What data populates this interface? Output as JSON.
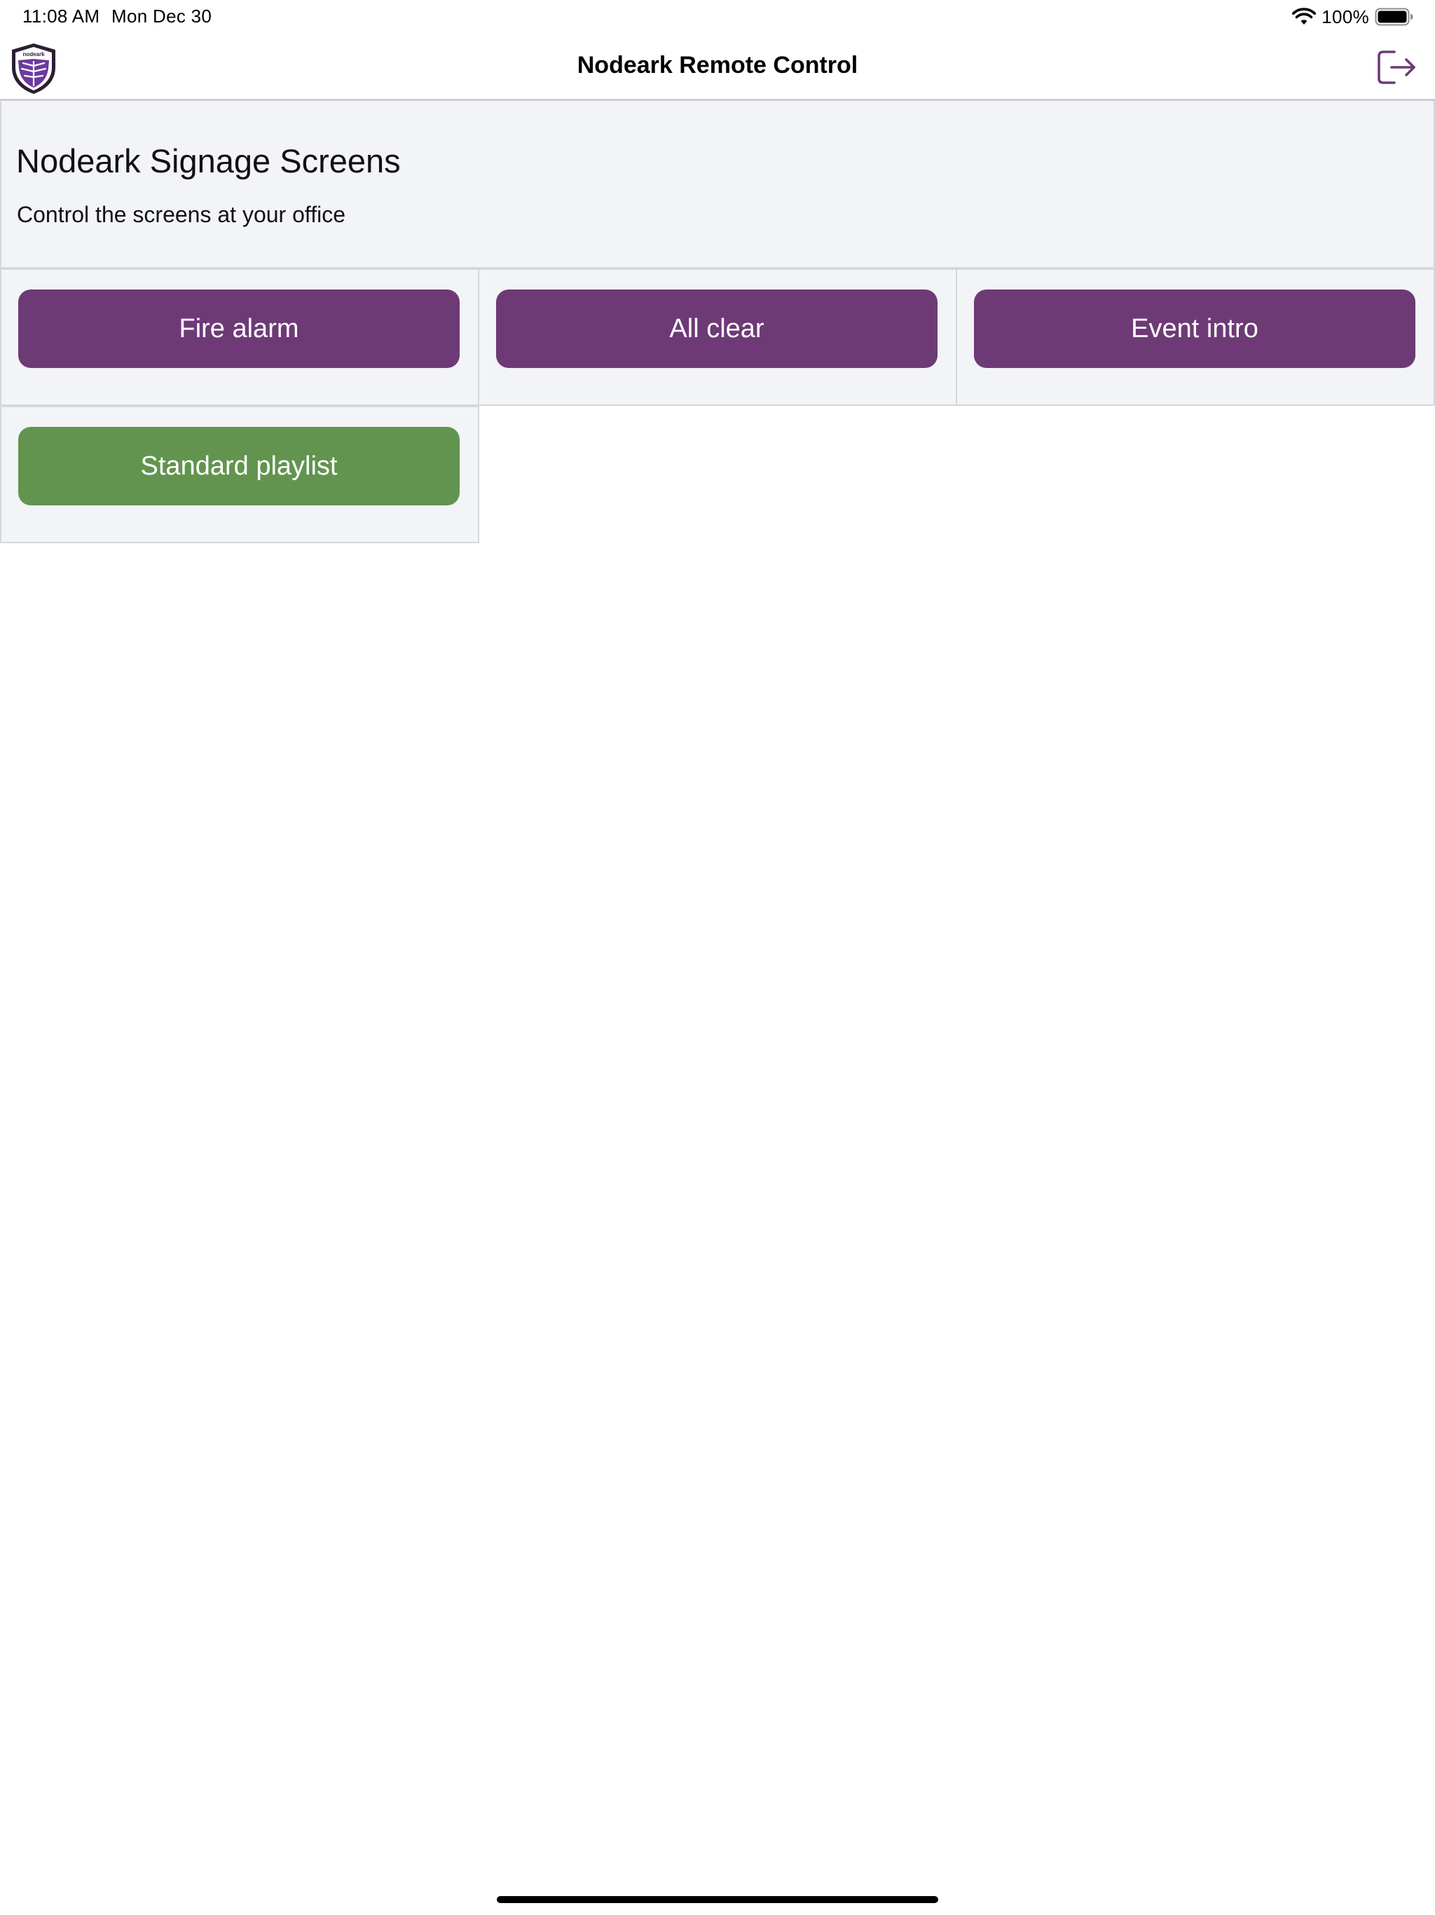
{
  "status_bar": {
    "time": "11:08 AM",
    "date": "Mon Dec 30",
    "battery": "100%"
  },
  "nav": {
    "title": "Nodeark Remote Control",
    "logo_icon": "nodeark-shield-logo-icon",
    "logout_icon": "logout-icon",
    "logo_wordmark": "nodeark"
  },
  "section": {
    "title": "Nodeark Signage Screens",
    "subtitle": "Control the screens at your office"
  },
  "actions": [
    {
      "label": "Fire alarm",
      "color": "#6d3a76"
    },
    {
      "label": "All clear",
      "color": "#6d3a76"
    },
    {
      "label": "Event intro",
      "color": "#6d3a76"
    },
    {
      "label": "Standard playlist",
      "color": "#62944f"
    }
  ],
  "colors": {
    "accent": "#6d3a76",
    "success": "#62944f",
    "panel_background": "#f2f4f8",
    "border": "#d5d7dc"
  }
}
